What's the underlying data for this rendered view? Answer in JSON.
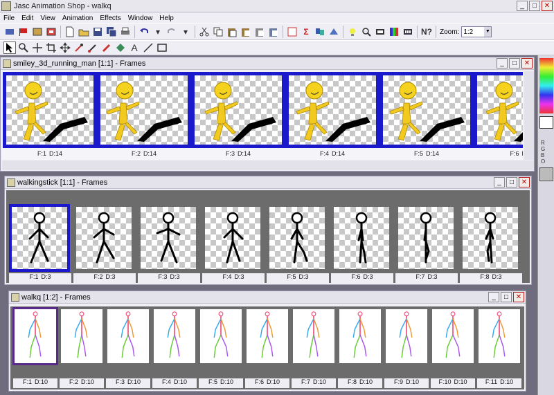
{
  "app": {
    "title": "Jasc Animation Shop - walkq"
  },
  "menu": [
    "File",
    "Edit",
    "View",
    "Animation",
    "Effects",
    "Window",
    "Help"
  ],
  "zoom": {
    "label": "Zoom:",
    "value": "1:2"
  },
  "panel_letters": [
    "R",
    "G",
    "B",
    "O"
  ],
  "windows": {
    "smiley": {
      "title": "smiley_3d_running_man [1:1] - Frames",
      "frames": [
        {
          "f": "F:1",
          "d": "D:14"
        },
        {
          "f": "F:2",
          "d": "D:14"
        },
        {
          "f": "F:3",
          "d": "D:14"
        },
        {
          "f": "F:4",
          "d": "D:14"
        },
        {
          "f": "F:5",
          "d": "D:14"
        },
        {
          "f": "F:6",
          "d": "D:1"
        }
      ]
    },
    "walkingstick": {
      "title": "walkingstick [1:1] - Frames",
      "frames": [
        {
          "f": "F:1",
          "d": "D:3"
        },
        {
          "f": "F:2",
          "d": "D:3"
        },
        {
          "f": "F:3",
          "d": "D:3"
        },
        {
          "f": "F:4",
          "d": "D:3"
        },
        {
          "f": "F:5",
          "d": "D:3"
        },
        {
          "f": "F:6",
          "d": "D:3"
        },
        {
          "f": "F:7",
          "d": "D:3"
        },
        {
          "f": "F:8",
          "d": "D:3"
        }
      ]
    },
    "walkq": {
      "title": "walkq [1:2] - Frames",
      "frames": [
        {
          "f": "F:1",
          "d": "D:10"
        },
        {
          "f": "F:2",
          "d": "D:10"
        },
        {
          "f": "F:3",
          "d": "D:10"
        },
        {
          "f": "F:4",
          "d": "D:10"
        },
        {
          "f": "F:5",
          "d": "D:10"
        },
        {
          "f": "F:6",
          "d": "D:10"
        },
        {
          "f": "F:7",
          "d": "D:10"
        },
        {
          "f": "F:8",
          "d": "D:10"
        },
        {
          "f": "F:9",
          "d": "D:10"
        },
        {
          "f": "F:10",
          "d": "D:10"
        },
        {
          "f": "F:11",
          "d": "D:10"
        }
      ]
    }
  }
}
